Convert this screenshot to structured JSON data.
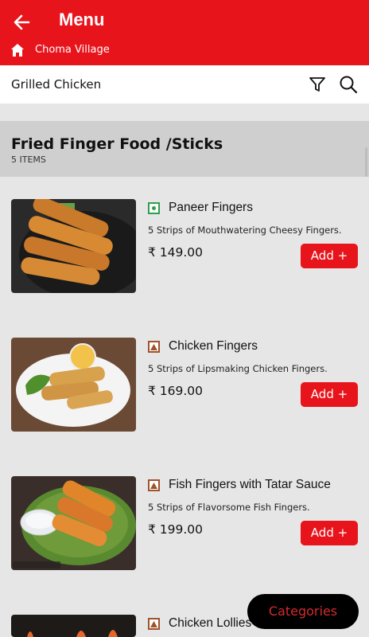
{
  "header": {
    "title": "Menu",
    "venue": "Choma Village",
    "back_icon": "back-arrow-icon",
    "home_icon": "home-icon"
  },
  "search": {
    "query": "Grilled Chicken",
    "filter_icon": "filter-icon",
    "search_icon": "search-icon"
  },
  "section": {
    "title": "Fried Finger Food /Sticks",
    "count": "5 ITEMS"
  },
  "items": [
    {
      "name": "Paneer Fingers",
      "description": "5 Strips of Mouthwatering Cheesy Fingers.",
      "price": "₹ 149.00",
      "add_label": "Add +",
      "diet": "veg"
    },
    {
      "name": "Chicken Fingers",
      "description": "5 Strips of Lipsmaking Chicken Fingers.",
      "price": "₹ 169.00",
      "add_label": "Add +",
      "diet": "non-veg"
    },
    {
      "name": "Fish Fingers with Tatar Sauce",
      "description": "5 Strips of  Flavorsome Fish Fingers.",
      "price": "₹ 199.00",
      "add_label": "Add +",
      "diet": "non-veg"
    },
    {
      "name": "Chicken Lollies",
      "diet": "non-veg"
    }
  ],
  "categories_button": "Categories",
  "colors": {
    "brand_red": "#e8141c",
    "veg_green": "#2e9e4f",
    "nonveg_brown": "#a0522d"
  }
}
